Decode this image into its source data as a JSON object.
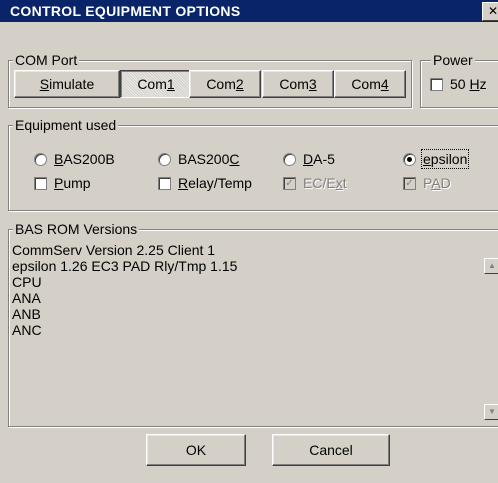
{
  "window": {
    "title": "CONTROL EQUIPMENT OPTIONS",
    "close_glyph": "✕"
  },
  "com_port": {
    "legend": "COM Port",
    "buttons": [
      {
        "label": "Simulate",
        "pre": "",
        "ul": "S",
        "post": "imulate"
      },
      {
        "label": "Com1",
        "pre": "Com",
        "ul": "1",
        "post": ""
      },
      {
        "label": "Com2",
        "pre": "Com",
        "ul": "2",
        "post": ""
      },
      {
        "label": "Com3",
        "pre": "Com",
        "ul": "3",
        "post": ""
      },
      {
        "label": "Com4",
        "pre": "Com",
        "ul": "4",
        "post": ""
      }
    ],
    "selected": "Com1"
  },
  "power": {
    "legend": "Power",
    "checkbox": {
      "pre": "50 ",
      "ul": "H",
      "post": "z",
      "checked": false
    }
  },
  "equipment": {
    "legend": "Equipment used",
    "radios": [
      {
        "pre": "",
        "ul": "B",
        "post": "AS200B",
        "checked": false
      },
      {
        "pre": "BAS200",
        "ul": "C",
        "post": "",
        "checked": false
      },
      {
        "pre": "",
        "ul": "D",
        "post": "A-5",
        "checked": false
      },
      {
        "pre": "",
        "ul": "e",
        "post": "psilon",
        "checked": true
      }
    ],
    "checks": [
      {
        "pre": "",
        "ul": "P",
        "post": "ump",
        "checked": false,
        "disabled": false
      },
      {
        "pre": "",
        "ul": "R",
        "post": "elay/Temp",
        "checked": false,
        "disabled": false
      },
      {
        "pre": "EC/E",
        "ul": "x",
        "post": "t",
        "checked": true,
        "disabled": true
      },
      {
        "pre": "P",
        "ul": "A",
        "post": "D",
        "checked": true,
        "disabled": true
      }
    ]
  },
  "rom": {
    "legend": "BAS ROM Versions",
    "lines": [
      "CommServ Version 2.25 Client 1",
      "epsilon 1.26  EC3 PAD Rly/Tmp 1.15",
      "CPU",
      "ANA",
      "ANB",
      "ANC"
    ]
  },
  "footer": {
    "ok": "OK",
    "cancel": "Cancel"
  }
}
